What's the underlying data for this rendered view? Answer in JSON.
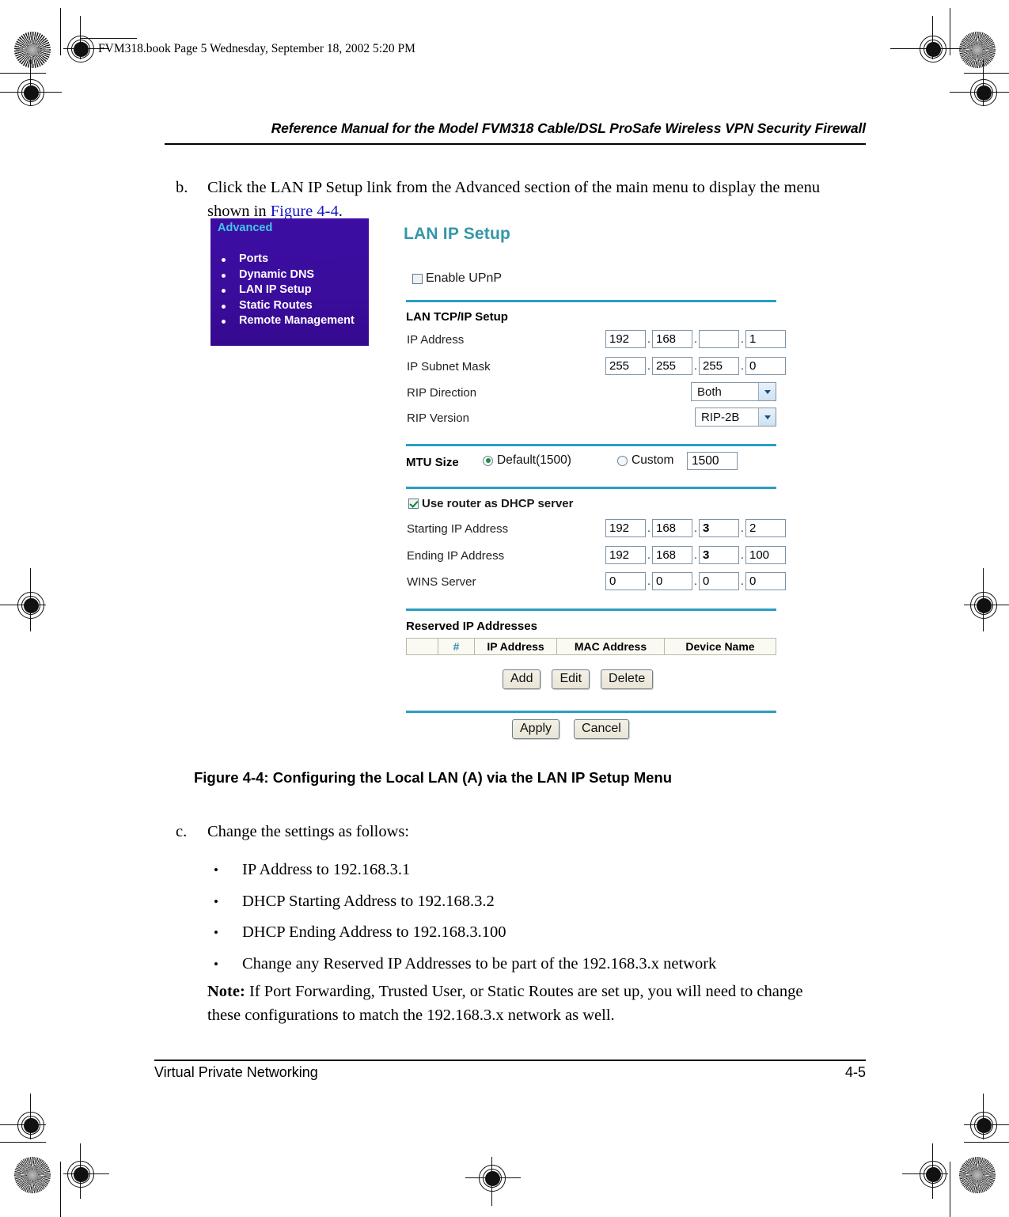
{
  "page_stamp": "FVM318.book  Page 5  Wednesday, September 18, 2002  5:20 PM",
  "running_head": "Reference Manual for the Model FVM318 Cable/DSL ProSafe Wireless VPN Security Firewall",
  "step_b": {
    "label": "b.",
    "text_before": "Click the LAN IP Setup link from the Advanced section of the main menu to display the menu shown in ",
    "xref": "Figure 4-4",
    "text_after": "."
  },
  "screenshot": {
    "nav": {
      "title": "Advanced",
      "items": [
        "Ports",
        "Dynamic DNS",
        "LAN IP Setup",
        "Static Routes",
        "Remote Management"
      ]
    },
    "panel_title": "LAN IP Setup",
    "upnp": {
      "label": "Enable UPnP",
      "checked": false
    },
    "tcpip": {
      "heading": "LAN TCP/IP Setup",
      "ip_address": {
        "label": "IP Address",
        "octets": [
          "192",
          "168",
          "",
          "1"
        ]
      },
      "subnet_mask": {
        "label": "IP Subnet Mask",
        "octets": [
          "255",
          "255",
          "255",
          "0"
        ]
      },
      "rip_direction": {
        "label": "RIP Direction",
        "value": "Both"
      },
      "rip_version": {
        "label": "RIP Version",
        "value": "RIP-2B"
      }
    },
    "mtu": {
      "label": "MTU Size",
      "default_label": "Default(1500)",
      "custom_label": "Custom",
      "custom_value": "1500",
      "selected": "default"
    },
    "dhcp": {
      "label": "Use router as DHCP server",
      "checked": true,
      "starting_ip": {
        "label": "Starting IP Address",
        "octets": [
          "192",
          "168",
          "3",
          "2"
        ]
      },
      "ending_ip": {
        "label": "Ending IP Address",
        "octets": [
          "192",
          "168",
          "3",
          "100"
        ]
      },
      "wins_server": {
        "label": "WINS Server",
        "octets": [
          "0",
          "0",
          "0",
          "0"
        ]
      }
    },
    "reserved": {
      "heading": "Reserved IP Addresses",
      "columns": [
        "",
        "#",
        "IP Address",
        "MAC Address",
        "Device Name"
      ],
      "rows": [],
      "buttons": [
        "Add",
        "Edit",
        "Delete"
      ]
    },
    "form_buttons": [
      "Apply",
      "Cancel"
    ],
    "colors": {
      "nav_background": "#3a0d9c",
      "nav_title": "#40c8e8",
      "panel_title": "#3596a8",
      "divider": "#2a9ec4",
      "hash_header": "#2a8fb0",
      "check_green": "#0a8a2a"
    }
  },
  "caption": "Figure 4-4: Configuring the Local LAN (A) via the LAN IP Setup Menu",
  "step_c": {
    "label": "c.",
    "text": "Change the settings as follows:"
  },
  "bullets": [
    "IP Address to 192.168.3.1",
    "DHCP Starting Address to 192.168.3.2",
    "DHCP Ending Address to 192.168.3.100",
    "Change any Reserved IP Addresses to be part of the 192.168.3.x network"
  ],
  "note": {
    "label": "Note:",
    "text": " If Port Forwarding, Trusted User, or Static Routes are set up, you will need to change these configurations to match the 192.168.3.x network as well."
  },
  "footer": {
    "left": "Virtual Private Networking",
    "right": "4-5"
  }
}
